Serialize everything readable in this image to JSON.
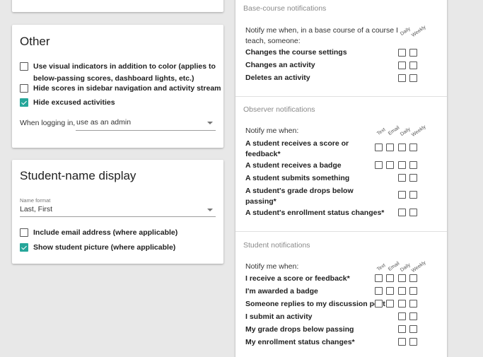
{
  "other": {
    "title": "Other",
    "options": [
      {
        "label_line1": "Use visual indicators in addition to color (applies to",
        "label_line2": "below-passing scores, dashboard lights, etc.)",
        "checked": false
      },
      {
        "label": "Hide scores in sidebar navigation and activity stream",
        "checked": false
      },
      {
        "label": "Hide excused activities",
        "checked": true
      }
    ],
    "login_label": "When logging in,",
    "login_value": "use as an admin"
  },
  "student_name": {
    "title": "Student-name display",
    "format_label": "Name format",
    "format_value": "Last, First",
    "options": [
      {
        "label": "Include email address (where applicable)",
        "checked": false
      },
      {
        "label": "Show student picture (where applicable)",
        "checked": true
      }
    ]
  },
  "notifications": {
    "columns": {
      "text": "Text",
      "email": "Email",
      "daily": "Daily",
      "weekly": "Weekly"
    },
    "base_course": {
      "title": "Base-course notifications",
      "notify_line1": "Notify me when, in a base course of a course I",
      "notify_line2": "teach, someone:",
      "rows": [
        "Changes the course settings",
        "Changes an activity",
        "Deletes an activity"
      ]
    },
    "observer": {
      "title": "Observer notifications",
      "notify": "Notify me when:",
      "rows": [
        {
          "line1": "A student receives a score or",
          "line2": "feedback*"
        },
        {
          "line1": "A student receives a badge",
          "line2": ""
        },
        {
          "line1": "A student submits something",
          "line2": ""
        },
        {
          "line1": "A student's grade drops below",
          "line2": "passing*"
        },
        {
          "line1": "A student's enrollment status changes*",
          "line2": ""
        }
      ]
    },
    "student": {
      "title": "Student notifications",
      "notify": "Notify me when:",
      "rows": [
        "I receive a score or feedback*",
        "I'm awarded a badge",
        "Someone replies to my discussion post",
        "I submit an activity",
        "My grade drops below passing",
        "My enrollment status changes*"
      ]
    }
  }
}
